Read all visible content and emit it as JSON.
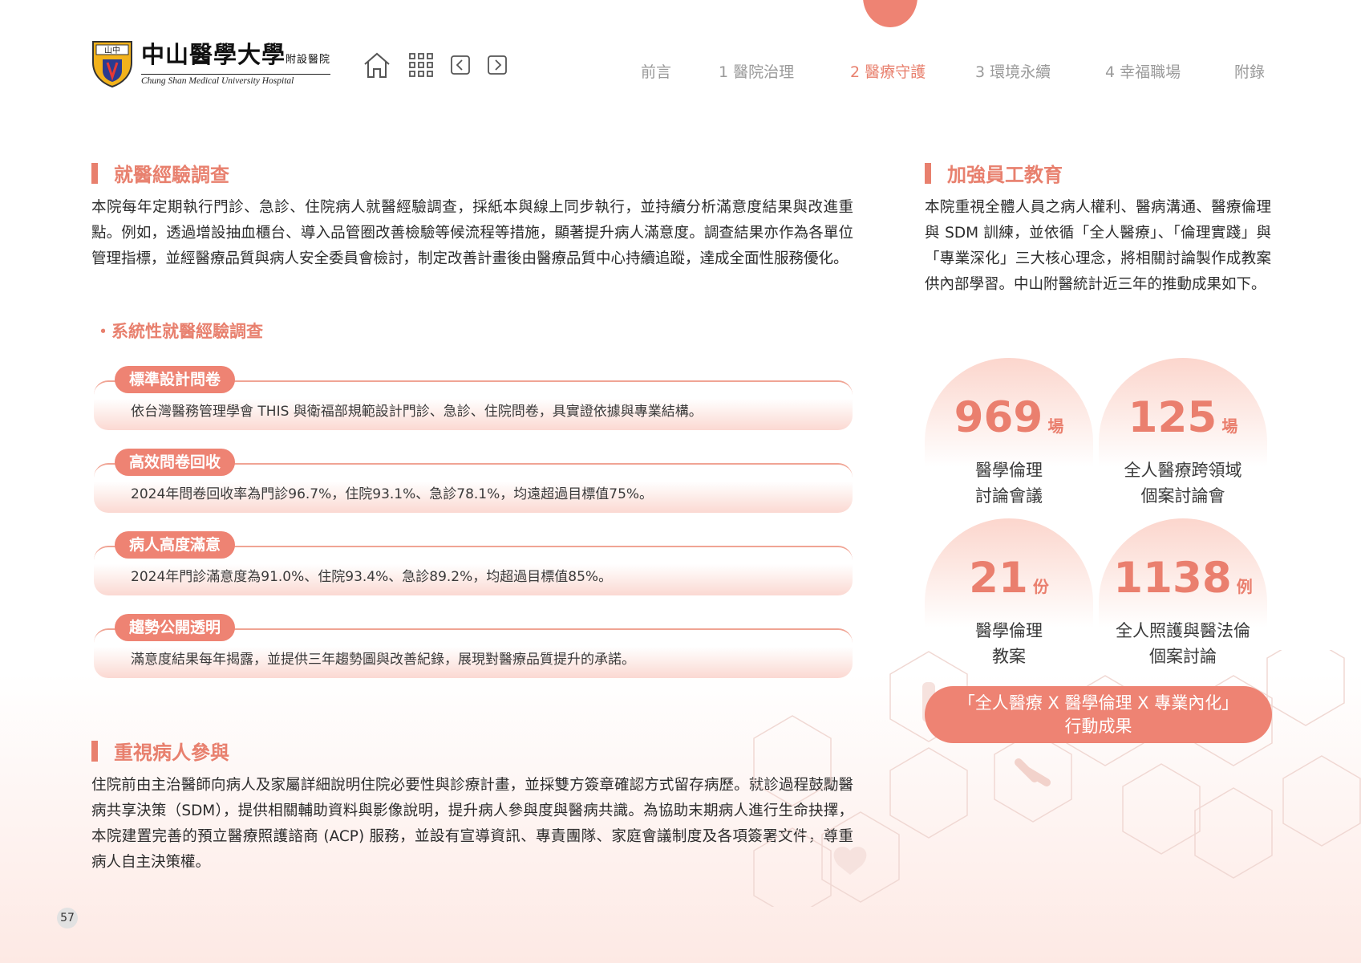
{
  "header": {
    "logo_zh": "中山醫學大學",
    "logo_zh_small": "附設醫院",
    "logo_en": "Chung Shan Medical University Hospital",
    "seal_text": "山中",
    "nav": [
      {
        "label": "前言"
      },
      {
        "label": "1 醫院治理"
      },
      {
        "label": "2 醫療守護"
      },
      {
        "label": "3 環境永續"
      },
      {
        "label": "4 幸福職場"
      },
      {
        "label": "附錄"
      }
    ],
    "active_index": 2
  },
  "colors": {
    "accent": "#e8806e",
    "accent_fill": "#ee8373",
    "card_tint": "#fbd9d2"
  },
  "left": {
    "section1": {
      "title": "就醫經驗調查",
      "body": "本院每年定期執行門診、急診、住院病人就醫經驗調查，採紙本與線上同步執行，並持續分析滿意度結果與改進重點。例如，透過增設抽血櫃台、導入品管圈改善檢驗等候流程等措施，顯著提升病人滿意度。調查結果亦作為各單位管理指標，並經醫療品質與病人安全委員會檢討，制定改善計畫後由醫療品質中心持續追蹤，達成全面性服務優化。"
    },
    "subheading": "・系統性就醫經驗調查",
    "cards": [
      {
        "tag": "標準設計問卷",
        "text": "依台灣醫務管理學會 THIS 與衛福部規範設計門診、急診、住院問卷，具實證依據與專業結構。"
      },
      {
        "tag": "高效問卷回收",
        "text": "2024年問卷回收率為門診96.7%，住院93.1%、急診78.1%，均遠超過目標值75%。"
      },
      {
        "tag": "病人高度滿意",
        "text": "2024年門診滿意度為91.0%、住院93.4%、急診89.2%，均超過目標值85%。"
      },
      {
        "tag": "趨勢公開透明",
        "text": "滿意度結果每年揭露，並提供三年趨勢圖與改善紀錄，展現對醫療品質提升的承諾。"
      }
    ],
    "section2": {
      "title": "重視病人參與",
      "body": "住院前由主治醫師向病人及家屬詳細說明住院必要性與診療計畫，並採雙方簽章確認方式留存病歷。就診過程鼓勵醫病共享決策（SDM），提供相關輔助資料與影像說明，提升病人參與度與醫病共識。為協助末期病人進行生命抉擇，本院建置完善的預立醫療照護諮商 (ACP) 服務，並設有宣導資訊、專責團隊、家庭會議制度及各項簽署文件，尊重病人自主決策權。"
    }
  },
  "right": {
    "section": {
      "title": "加強員工教育",
      "body": "本院重視全體人員之病人權利、醫病溝通、醫療倫理與 SDM 訓練，並依循「全人醫療」、「倫理實踐」與「專業深化」三大核心理念，將相關討論製作成教案供內部學習。中山附醫統計近三年的推動成果如下。"
    },
    "stats": [
      {
        "value": "969",
        "unit": "場",
        "label1": "醫學倫理",
        "label2": "討論會議"
      },
      {
        "value": "125",
        "unit": "場",
        "label1": "全人醫療跨領域",
        "label2": "個案討論會"
      },
      {
        "value": "21",
        "unit": "份",
        "label1": "醫學倫理",
        "label2": "教案"
      },
      {
        "value": "1138",
        "unit": "例",
        "label1": "全人照護與醫法倫",
        "label2": "個案討論"
      }
    ],
    "cta_line1": "「全人醫療 X 醫學倫理 X 專業內化」",
    "cta_line2": "行動成果"
  },
  "footer": {
    "page_number": "57"
  }
}
